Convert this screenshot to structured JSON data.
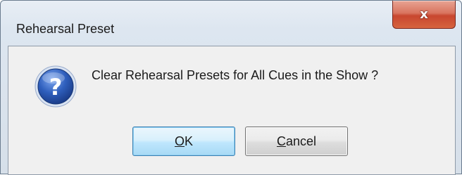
{
  "window": {
    "title": "Rehearsal Preset",
    "close_icon": "close-icon",
    "close_glyph": "x"
  },
  "dialog": {
    "icon": "question-icon",
    "message": "Clear Rehearsal Presets for All Cues in the Show ?",
    "buttons": [
      {
        "label_mnemonic": "O",
        "label_rest": "K"
      },
      {
        "label_mnemonic": "C",
        "label_rest": "ancel"
      }
    ]
  },
  "colors": {
    "close_button": "#c8462f",
    "question_icon": "#2f5fbd",
    "ok_border": "#3c7fb1"
  }
}
